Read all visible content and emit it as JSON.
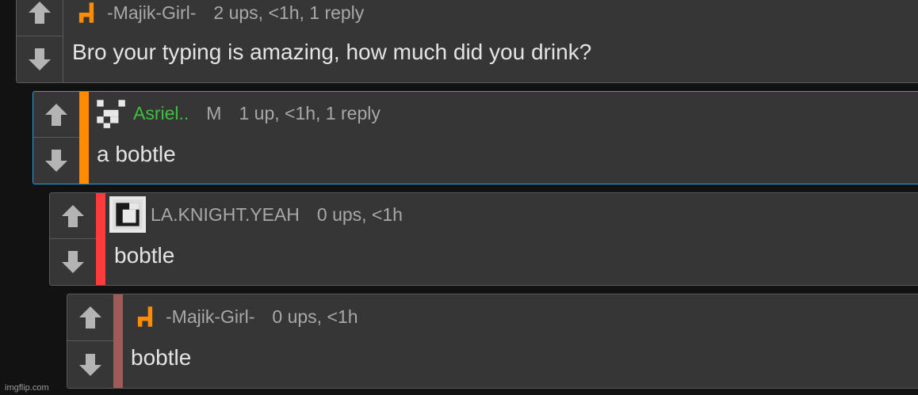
{
  "watermark": "imgflip.com",
  "colors": {
    "panel": "#363636",
    "border": "#5a5a5a",
    "highlight_border": "#2a9fd6",
    "stripe_orange": "#ff8c00",
    "stripe_red": "#ff3b3b",
    "stripe_brown": "#a05a5a",
    "username_green": "#3fbf3f"
  },
  "comments": [
    {
      "username": "-Majik-Girl-",
      "stats": "2 ups, <1h, 1 reply",
      "body": "Bro your typing is amazing, how much did you drink?",
      "avatar_icon": "orange-chair-icon"
    },
    {
      "username": "Asriel..",
      "badge": "M",
      "stats": "1 up, <1h, 1 reply",
      "body": "a bobtle",
      "avatar_icon": "pixel-face-icon"
    },
    {
      "username": "LA.KNIGHT.YEAH",
      "stats": "0 ups, <1h",
      "body": "bobtle",
      "avatar_icon": "pixel-square-icon"
    },
    {
      "username": "-Majik-Girl-",
      "stats": "0 ups, <1h",
      "body": "bobtle",
      "avatar_icon": "orange-chair-icon"
    }
  ]
}
